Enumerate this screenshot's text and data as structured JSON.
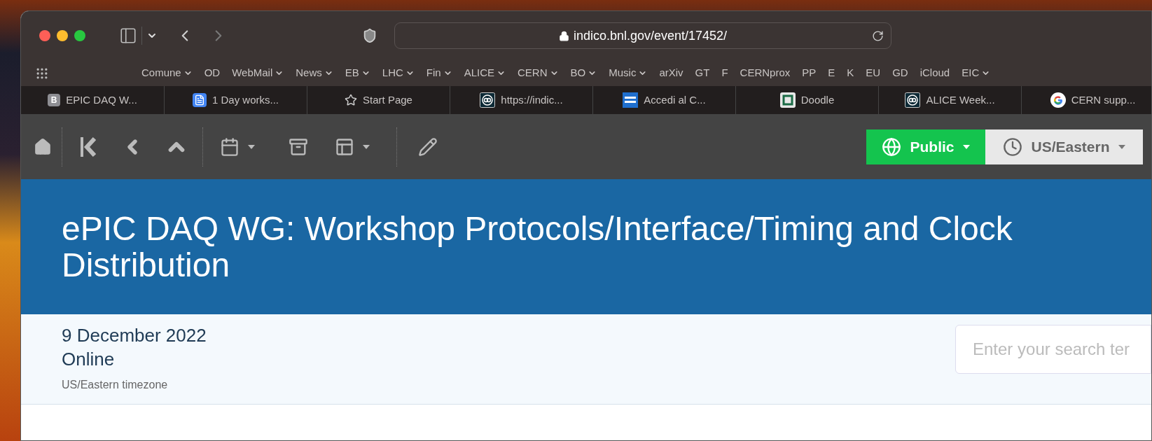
{
  "address_bar": {
    "url": "indico.bnl.gov/event/17452/"
  },
  "bookmarks": [
    {
      "label": "Comune",
      "menu": true
    },
    {
      "label": "OD",
      "menu": false
    },
    {
      "label": "WebMail",
      "menu": true
    },
    {
      "label": "News",
      "menu": true
    },
    {
      "label": "EB",
      "menu": true
    },
    {
      "label": "LHC",
      "menu": true
    },
    {
      "label": "Fin",
      "menu": true
    },
    {
      "label": "ALICE",
      "menu": true
    },
    {
      "label": "CERN",
      "menu": true
    },
    {
      "label": "BO",
      "menu": true
    },
    {
      "label": "Music",
      "menu": true
    },
    {
      "label": "arXiv",
      "menu": false
    },
    {
      "label": "GT",
      "menu": false
    },
    {
      "label": "F",
      "menu": false
    },
    {
      "label": "CERNprox",
      "menu": false
    },
    {
      "label": "PP",
      "menu": false
    },
    {
      "label": "E",
      "menu": false
    },
    {
      "label": "K",
      "menu": false
    },
    {
      "label": "EU",
      "menu": false
    },
    {
      "label": "GD",
      "menu": false
    },
    {
      "label": "iCloud",
      "menu": false
    },
    {
      "label": "EIC",
      "menu": true
    }
  ],
  "tabs": [
    {
      "title": "EPIC DAQ W...",
      "kind": "letter",
      "icon_letter": "B"
    },
    {
      "title": "1 Day works...",
      "kind": "doc"
    },
    {
      "title": "Start Page",
      "kind": "star"
    },
    {
      "title": "https://indic...",
      "kind": "indico"
    },
    {
      "title": "Accedi al C...",
      "kind": "card"
    },
    {
      "title": "Doodle",
      "kind": "doodle"
    },
    {
      "title": "ALICE Week...",
      "kind": "indico"
    },
    {
      "title": "CERN supp...",
      "kind": "google"
    }
  ],
  "toolbar": {
    "protection": "Public",
    "timezone": "US/Eastern"
  },
  "event": {
    "title": "ePIC DAQ WG: Workshop Protocols/Interface/Timing and Clock Distribution",
    "date": "9 December 2022",
    "location": "Online",
    "timezone_note": "US/Eastern timezone",
    "search": {
      "placeholder": "Enter your search ter"
    }
  }
}
